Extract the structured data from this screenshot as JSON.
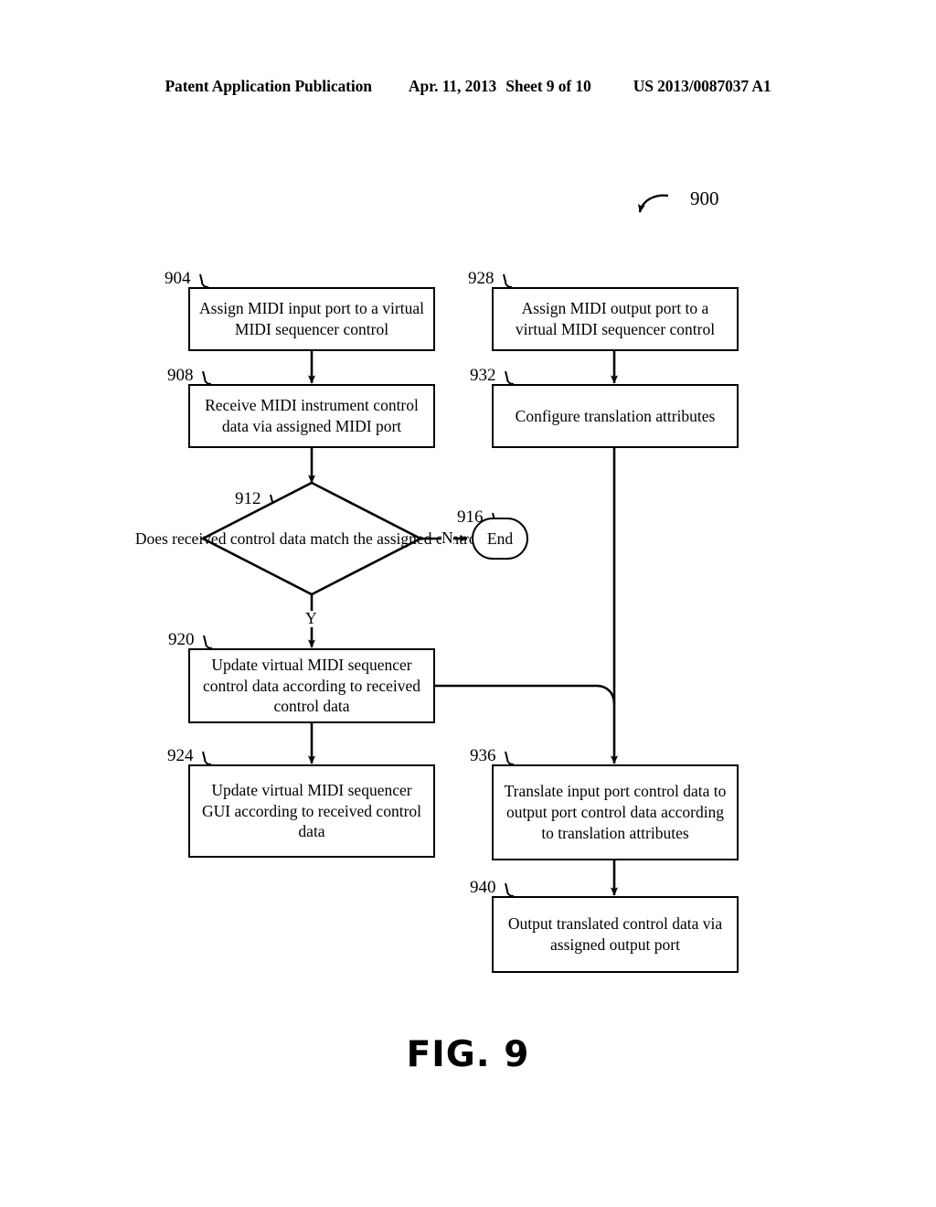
{
  "header": {
    "publication": "Patent Application Publication",
    "date": "Apr. 11, 2013",
    "sheet": "Sheet 9 of 10",
    "patent_number": "US 2013/0087037 A1"
  },
  "figure": {
    "caption": "FIG. 9",
    "diagram_ref": "900",
    "ink_color": "#000000",
    "background_color": "#ffffff"
  },
  "flowchart": {
    "type": "flowchart",
    "nodes": [
      {
        "id": "904",
        "ref": "904",
        "shape": "process",
        "text": "Assign MIDI input port to a virtual MIDI sequencer control",
        "lines": [
          "Assign MIDI input port to a",
          "virtual MIDI sequencer control"
        ],
        "column": "left"
      },
      {
        "id": "908",
        "ref": "908",
        "shape": "process",
        "text": "Receive MIDI instrument control data via assigned MIDI port",
        "lines": [
          "Receive MIDI instrument control",
          "data via assigned MIDI port"
        ],
        "column": "left"
      },
      {
        "id": "912",
        "ref": "912",
        "shape": "decision",
        "text": "Does received control data match the assigned control?",
        "lines": [
          "Does",
          "received control data",
          "match the assigned",
          "control?"
        ],
        "column": "left"
      },
      {
        "id": "916",
        "ref": "916",
        "shape": "terminal",
        "text": "End",
        "lines": [
          "End"
        ],
        "column": "left"
      },
      {
        "id": "920",
        "ref": "920",
        "shape": "process",
        "text": "Update virtual MIDI sequencer control data according to received control data",
        "lines": [
          "Update virtual MIDI sequencer",
          "control data according to",
          "received control data"
        ],
        "column": "left"
      },
      {
        "id": "924",
        "ref": "924",
        "shape": "process",
        "text": "Update virtual MIDI sequencer GUI according to received control data",
        "lines": [
          "Update virtual MIDI sequencer",
          "GUI according to received",
          "control data"
        ],
        "column": "left"
      },
      {
        "id": "928",
        "ref": "928",
        "shape": "process",
        "text": "Assign MIDI output port to a virtual MIDI sequencer control",
        "lines": [
          "Assign MIDI output port to a",
          "virtual MIDI sequencer control"
        ],
        "column": "right"
      },
      {
        "id": "932",
        "ref": "932",
        "shape": "process",
        "text": "Configure translation attributes",
        "lines": [
          "Configure translation attributes"
        ],
        "column": "right"
      },
      {
        "id": "936",
        "ref": "936",
        "shape": "process",
        "text": "Translate input port control data to output port control data according to translation attributes",
        "lines": [
          "Translate input port control data",
          "to output port control data",
          "according to translation",
          "attributes"
        ],
        "column": "right"
      },
      {
        "id": "940",
        "ref": "940",
        "shape": "process",
        "text": "Output translated control data via assigned output port",
        "lines": [
          "Output translated control data",
          "via assigned output port"
        ],
        "column": "right"
      }
    ],
    "edges": [
      {
        "from": "904",
        "to": "908",
        "label": ""
      },
      {
        "from": "908",
        "to": "912",
        "label": ""
      },
      {
        "from": "912",
        "to": "916",
        "label": "N"
      },
      {
        "from": "912",
        "to": "920",
        "label": "Y"
      },
      {
        "from": "920",
        "to": "924",
        "label": ""
      },
      {
        "from": "920",
        "to": "936",
        "label": ""
      },
      {
        "from": "928",
        "to": "932",
        "label": ""
      },
      {
        "from": "932",
        "to": "936",
        "label": ""
      },
      {
        "from": "936",
        "to": "940",
        "label": ""
      }
    ],
    "branch_labels": {
      "yes": "Y",
      "no": "N"
    }
  }
}
